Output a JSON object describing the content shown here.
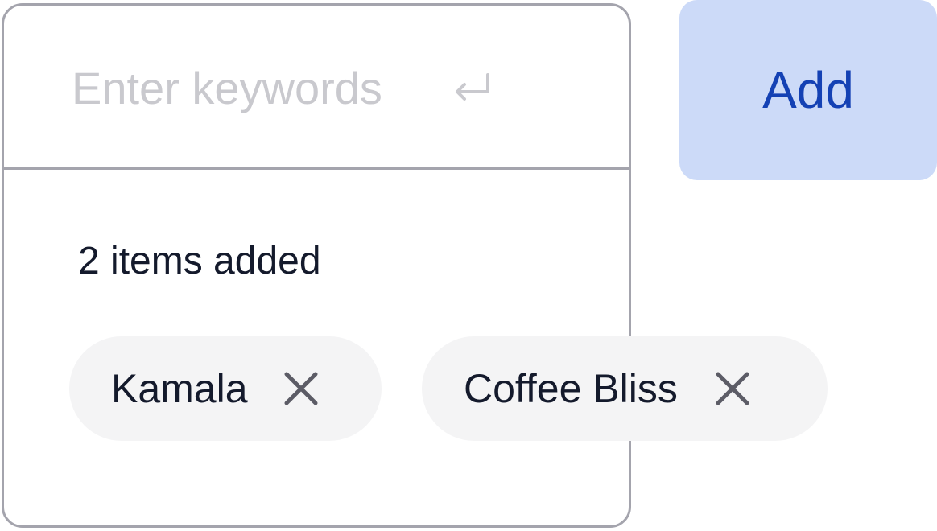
{
  "keyword_input": {
    "placeholder": "Enter keywords",
    "value": "",
    "submit_hint_icon": "enter-return-icon"
  },
  "add_button": {
    "label": "Add"
  },
  "added_list": {
    "count_text": "2 items added",
    "items": [
      {
        "label": "Kamala",
        "remove_icon": "close-icon"
      },
      {
        "label": "Coffee Bliss",
        "remove_icon": "close-icon"
      }
    ]
  },
  "colors": {
    "border": "#a4a4ad",
    "placeholder": "#c9c9ce",
    "text": "#141a2c",
    "chip_background": "#f4f4f5",
    "icon": "#5c5c66",
    "button_background": "#ccdaf8",
    "button_text": "#1441b4"
  }
}
